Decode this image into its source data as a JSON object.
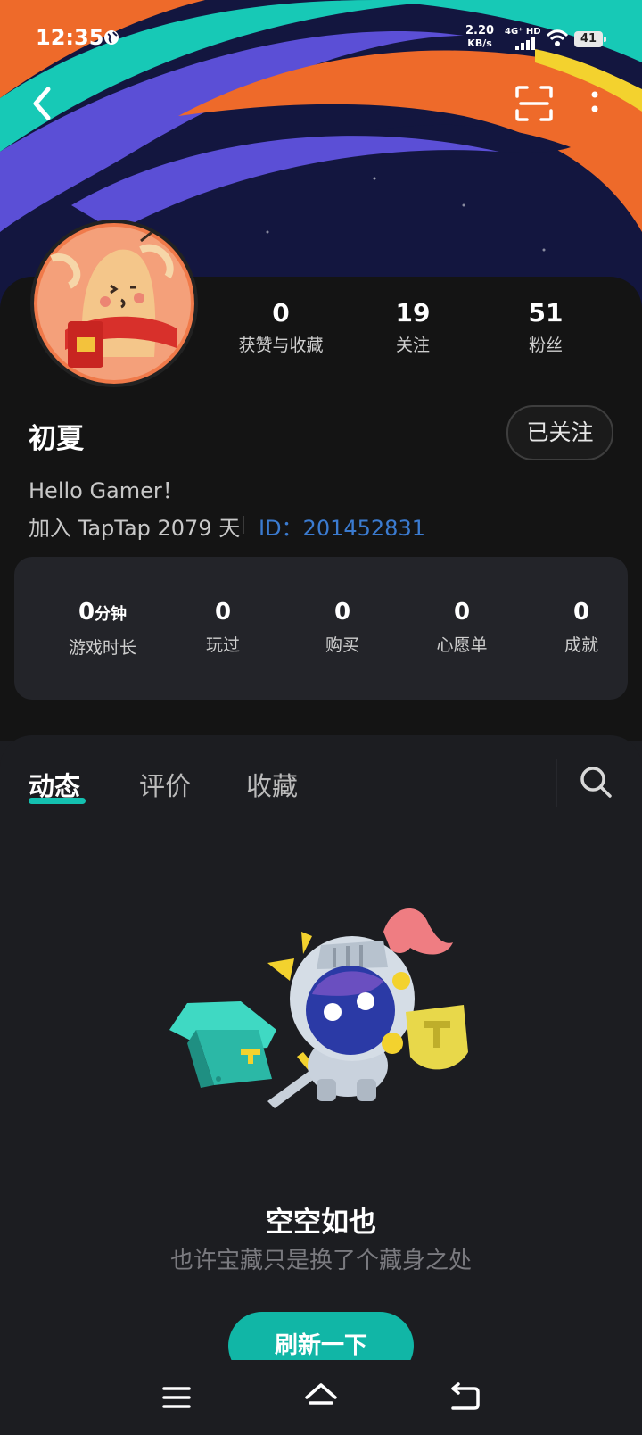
{
  "status_bar": {
    "time": "12:35",
    "net_speed_value": "2.20",
    "net_speed_unit": "KB/s",
    "network_type": "4G⁺ HD",
    "battery": "41"
  },
  "profile": {
    "username": "初夏",
    "follow_button": "已关注",
    "bio": "Hello Gamer！",
    "joined": "加入 TapTap 2079 天",
    "id_text": "ID：201452831",
    "stats": [
      {
        "value": "0",
        "label": "获赞与收藏"
      },
      {
        "value": "19",
        "label": "关注"
      },
      {
        "value": "51",
        "label": "粉丝"
      }
    ]
  },
  "game_stats": [
    {
      "value": "0",
      "unit": "分钟",
      "label": "游戏时长"
    },
    {
      "value": "0",
      "unit": "",
      "label": "玩过"
    },
    {
      "value": "0",
      "unit": "",
      "label": "购买"
    },
    {
      "value": "0",
      "unit": "",
      "label": "心愿单"
    },
    {
      "value": "0",
      "unit": "",
      "label": "成就"
    }
  ],
  "tabs": [
    {
      "label": "动态",
      "active": true
    },
    {
      "label": "评价",
      "active": false
    },
    {
      "label": "收藏",
      "active": false
    }
  ],
  "empty_state": {
    "title": "空空如也",
    "subtitle": "也许宝藏只是换了个藏身之处",
    "button": "刷新一下"
  },
  "icons": {
    "back": "chevron-left-icon",
    "scan": "scan-icon",
    "more": "more-vertical-icon",
    "search": "search-icon",
    "nav_menu": "menu-icon",
    "nav_home": "home-icon",
    "nav_back": "return-icon"
  },
  "colors": {
    "accent": "#14c0b0",
    "id_link": "#3b7bd0",
    "background": "#1c1d21"
  }
}
